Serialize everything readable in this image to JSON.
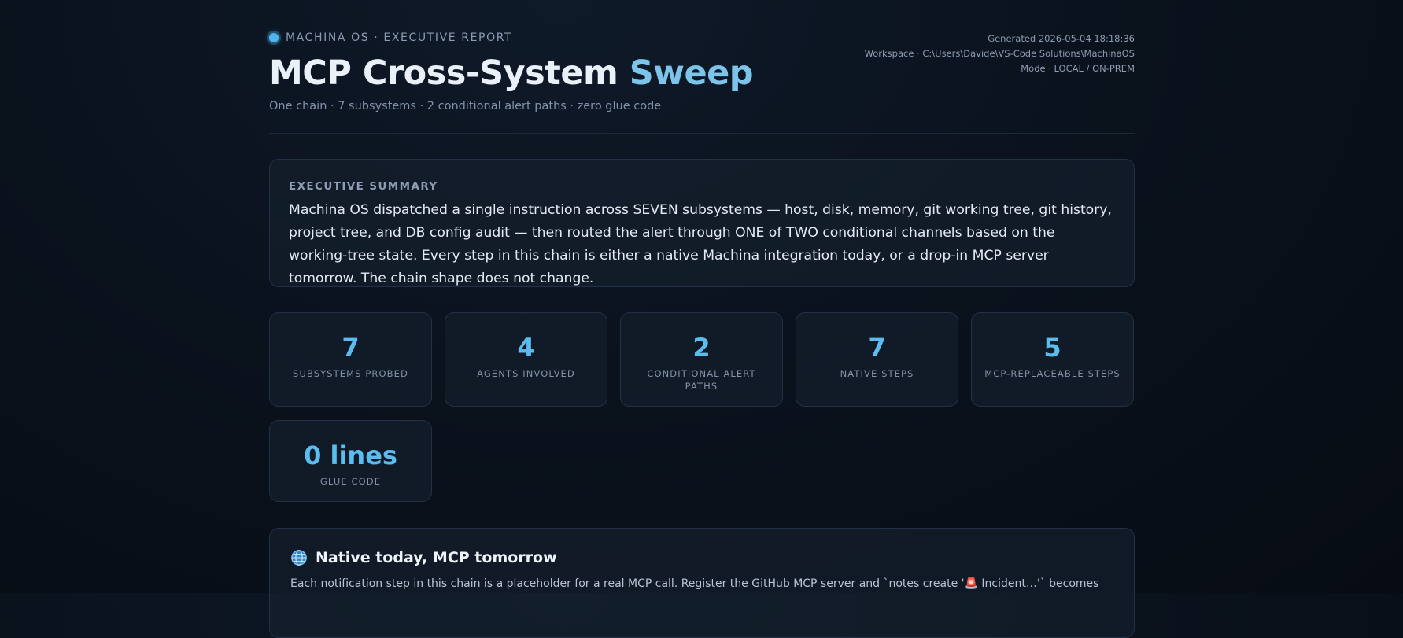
{
  "header": {
    "kicker": "MACHINA OS · EXECUTIVE REPORT",
    "title_main": "MCP Cross-System",
    "title_accent": "Sweep",
    "subtitle": "One chain · 7 subsystems · 2 conditional alert paths · zero glue code",
    "generated": "Generated 2026-05-04 18:18:36",
    "workspace": "Workspace · C:\\Users\\Davide\\VS-Code Solutions\\MachinaOS",
    "mode": "Mode · LOCAL / ON-PREM"
  },
  "summary": {
    "heading": "EXECUTIVE SUMMARY",
    "body": "Machina OS dispatched a single instruction across SEVEN subsystems — host, disk, memory, git working tree, git history, project tree, and DB config audit — then routed the alert through ONE of TWO conditional channels based on the working-tree state. Every step in this chain is either a native Machina integration today, or a drop-in MCP server tomorrow. The chain shape does not change."
  },
  "stats": [
    {
      "value": "7",
      "label": "SUBSYSTEMS PROBED"
    },
    {
      "value": "4",
      "label": "AGENTS INVOLVED"
    },
    {
      "value": "2",
      "label": "CONDITIONAL ALERT PATHS"
    },
    {
      "value": "7",
      "label": "NATIVE STEPS"
    },
    {
      "value": "5",
      "label": "MCP-REPLACEABLE STEPS"
    },
    {
      "value": "0 lines",
      "label": "GLUE CODE"
    }
  ],
  "native": {
    "icon": "globe-icon",
    "heading": "Native today, MCP tomorrow",
    "body": "Each notification step in this chain is a placeholder for a real MCP call. Register the GitHub MCP server and `notes create '🚨 Incident…'` becomes"
  },
  "colors": {
    "accent": "#5bbcf0",
    "title_accent": "#7cc4ea",
    "background": "#0a121d"
  }
}
